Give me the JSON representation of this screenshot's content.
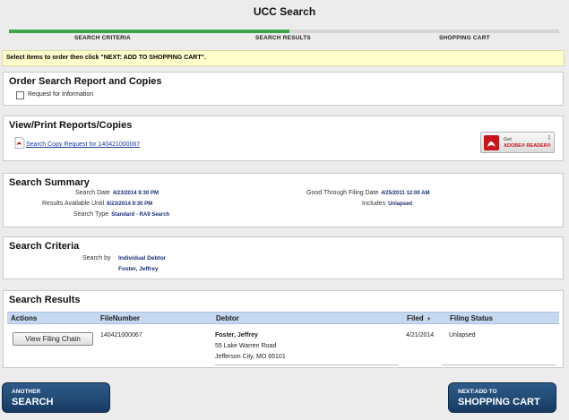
{
  "title": "UCC Search",
  "progress": {
    "percent": 51
  },
  "steps": [
    "SEARCH CRITERIA",
    "SEARCH RESULTS",
    "SHOPPING CART"
  ],
  "notice": "Select items to order then click \"NEXT: ADD TO SHOPPING CART\".",
  "order": {
    "heading": "Order Search Report and Copies",
    "checkbox_label": "Request for Information",
    "checked": false
  },
  "view": {
    "heading": "View/Print Reports/Copies",
    "link": "Search Copy Request for 140421000067",
    "adobe_get": "Get",
    "adobe_name": "ADOBE® READER®",
    "adobe_icon": "pdf-icon"
  },
  "summary": {
    "heading": "Search Summary",
    "search_date_label": "Search Date",
    "search_date": "4/23/2014 9:30 PM",
    "results_label": "Results Available Until",
    "results_until": "6/23/2014 9:30 PM",
    "type_label": "Search Type",
    "type": "Standard - RA9 Search",
    "good_label": "Good Through Filing Date",
    "good_through": "4/25/2011 12:00 AM",
    "includes_label": "Includes",
    "includes": "Unlapsed"
  },
  "criteria": {
    "heading": "Search Criteria",
    "label": "Search by",
    "by": "Individual Debtor",
    "name": "Foster, Jeffrey"
  },
  "results": {
    "heading": "Search Results",
    "columns": [
      "Actions",
      "FileNumber",
      "Debtor",
      "Filed",
      "Filing Status"
    ],
    "rows": [
      {
        "action": "View Filing Chain",
        "file_number": "140421000067",
        "debtor_name": "Foster, Jeffrey",
        "address1": "55 Lake Warren Road",
        "address2": "Jefferson City, MO 65101",
        "filed": "4/21/2014",
        "status": "Unlapsed"
      }
    ]
  },
  "buttons": {
    "another_small": "ANOTHER",
    "another_big": "SEARCH",
    "next_small": "NEXT:ADD TO",
    "next_big": "SHOPPING CART"
  },
  "colors": {
    "progress": "#3aa84a",
    "notice_bg": "#ffffcc",
    "table_header": "#c5d9f0",
    "nav_button": "#1f4a75",
    "value_text": "#1a2f7a",
    "link": "#1a3ea0"
  }
}
